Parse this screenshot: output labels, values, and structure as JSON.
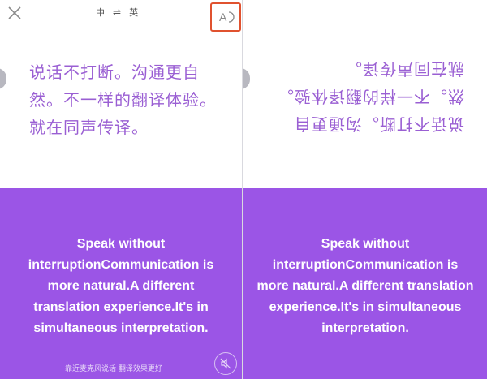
{
  "header": {
    "lang_from": "中",
    "lang_swap": "⇌",
    "lang_to": "英",
    "font_button": "A"
  },
  "source_text": "说话不打断。沟通更自然。不一样的翻译体验。就在同声传译。",
  "translation_text": "Speak without interruptionCommunication is more natural.A different translation experience.It's in simultaneous interpretation.",
  "footer_note": "靠近麦克风说话 翻译效果更好",
  "colors": {
    "accent_purple": "#9b55e6",
    "source_text": "#9a5fd3",
    "highlight_border": "#e0522f"
  }
}
